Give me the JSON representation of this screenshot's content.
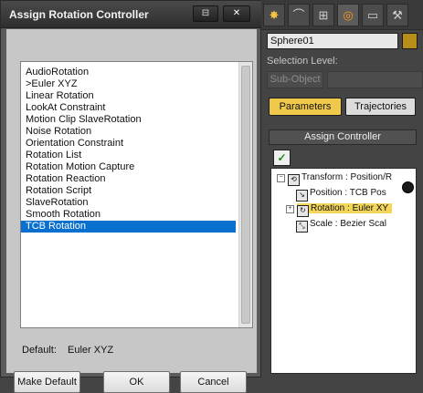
{
  "dialog": {
    "title": "Assign Rotation Controller",
    "title_buttons": {
      "pin": "⊟",
      "close": "✕"
    },
    "controllers": [
      "AudioRotation",
      ">Euler XYZ",
      "Linear Rotation",
      "LookAt Constraint",
      "Motion Clip SlaveRotation",
      "Noise Rotation",
      "Orientation Constraint",
      "Rotation List",
      "Rotation Motion Capture",
      "Rotation Reaction",
      "Rotation Script",
      "SlaveRotation",
      "Smooth Rotation",
      "TCB Rotation"
    ],
    "selected": "TCB Rotation",
    "default_label": "Default:",
    "default_value": "Euler XYZ",
    "buttons": {
      "make_default": "Make Default",
      "ok": "OK",
      "cancel": "Cancel"
    }
  },
  "command_panel": {
    "tab_icons": [
      "sun-create-icon",
      "curve-modify-icon",
      "hierarchy-icon",
      "motion-icon",
      "display-icon",
      "utilities-hammer-icon"
    ],
    "active_tab": "motion-icon",
    "object_name": "Sphere01",
    "object_color": "#b88e1b",
    "selection_level_label": "Selection Level:",
    "sub_object": "Sub-Object",
    "parameters": "Parameters",
    "trajectories": "Trajectories",
    "rollout_title": "Assign Controller",
    "tree": [
      {
        "label": "Transform : Position/R",
        "expander": "−"
      },
      {
        "label": "Position : TCB Pos"
      },
      {
        "label": "Rotation : Euler XY",
        "expander": "+",
        "highlighted": true
      },
      {
        "label": "Scale : Bezier Scal"
      }
    ]
  },
  "colors": {
    "accent_selection": "#0a70cf",
    "active_button": "#f0c94b",
    "active_tab_icon": "#ff9a1a"
  }
}
